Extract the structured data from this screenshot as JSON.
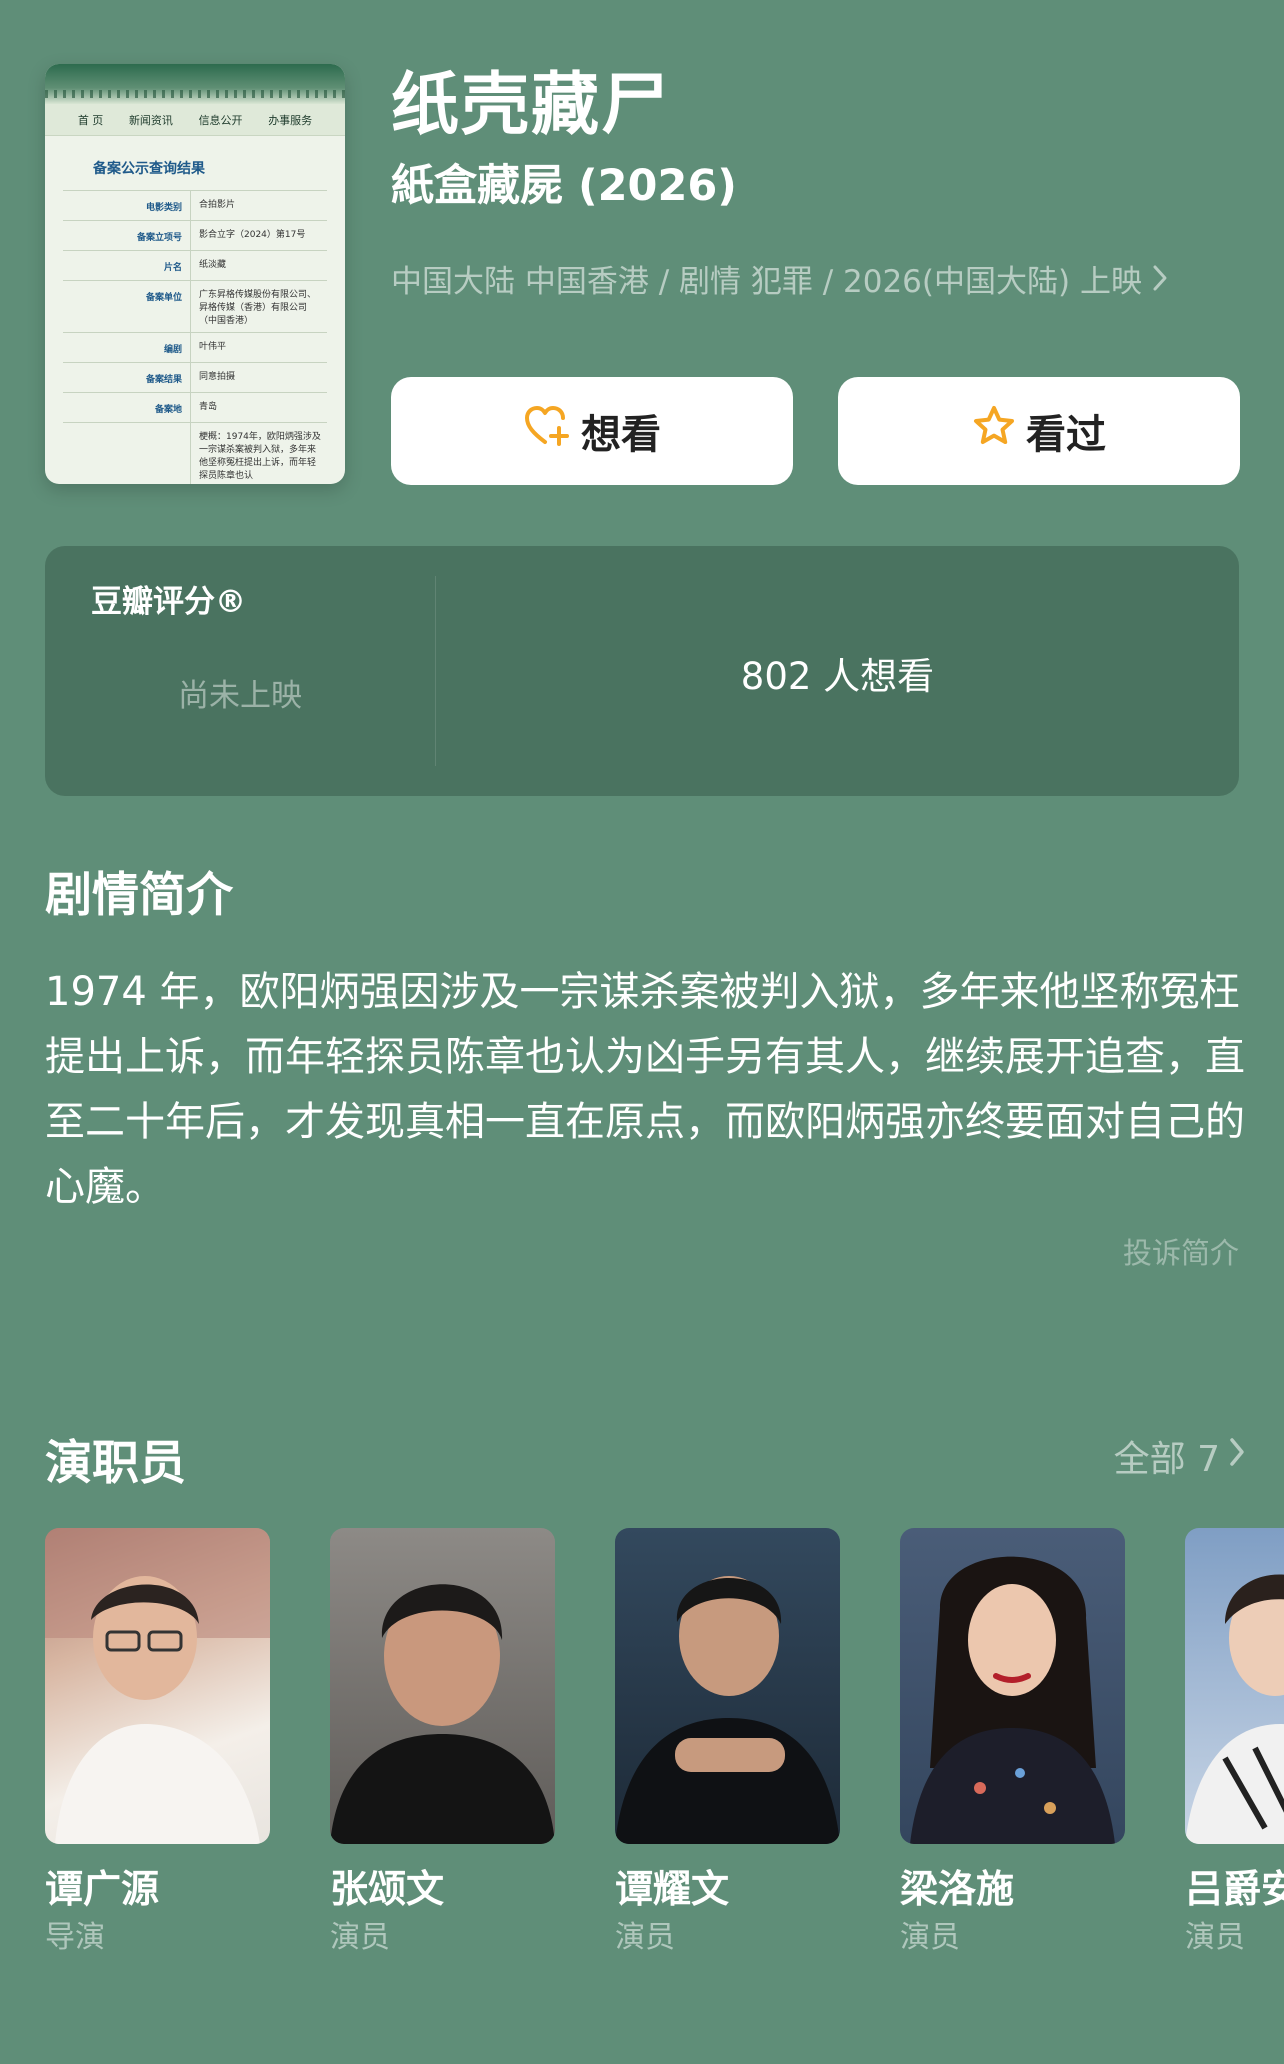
{
  "movie": {
    "title": "纸壳藏尸",
    "original_title": "紙盒藏屍 (2026)",
    "meta": "中国大陆 中国香港 / 剧情 犯罪 / 2026(中国大陆) 上映"
  },
  "poster": {
    "nav": [
      "首 页",
      "新闻资讯",
      "信息公开",
      "办事服务"
    ],
    "heading": "备案公示查询结果",
    "rows": [
      {
        "key": "电影类别",
        "value": "合拍影片"
      },
      {
        "key": "备案立项号",
        "value": "影合立字（2024）第17号"
      },
      {
        "key": "片名",
        "value": "纸淡藏"
      },
      {
        "key": "备案单位",
        "value": "广东昇格传媒股份有限公司、昇格传媒（香港）有限公司（中国香港）"
      },
      {
        "key": "编剧",
        "value": "叶伟平"
      },
      {
        "key": "备案结果",
        "value": "同意拍摄"
      },
      {
        "key": "备案地",
        "value": "青岛"
      },
      {
        "key": "",
        "value": "梗概：1974年，欧阳炳强涉及一宗谋杀案被判入狱，多年来他坚称冤枉提出上诉，而年轻探员陈章也认"
      }
    ]
  },
  "actions": {
    "want_label": "想看",
    "seen_label": "看过"
  },
  "rating": {
    "label": "豆瓣评分®",
    "status": "尚未上映",
    "wish_count": "802 人想看"
  },
  "synopsis": {
    "title": "剧情简介",
    "text": "1974 年，欧阳炳强因涉及一宗谋杀案被判入狱，多年来他坚称冤枉提出上诉，而年轻探员陈章也认为凶手另有其人，继续展开追查，直至二十年后，才发现真相一直在原点，而欧阳炳强亦终要面对自己的心魔。",
    "complaint_label": "投诉简介"
  },
  "cast": {
    "title": "演职员",
    "all_label": "全部 7",
    "members": [
      {
        "name": "谭广源",
        "role": "导演"
      },
      {
        "name": "张颂文",
        "role": "演员"
      },
      {
        "name": "谭耀文",
        "role": "演员"
      },
      {
        "name": "梁洛施",
        "role": "演员"
      },
      {
        "name": "吕爵安",
        "role": "演员"
      }
    ]
  },
  "colors": {
    "background": "#5f8e78",
    "card": "#4a7360",
    "accent_orange": "#f5a623"
  }
}
